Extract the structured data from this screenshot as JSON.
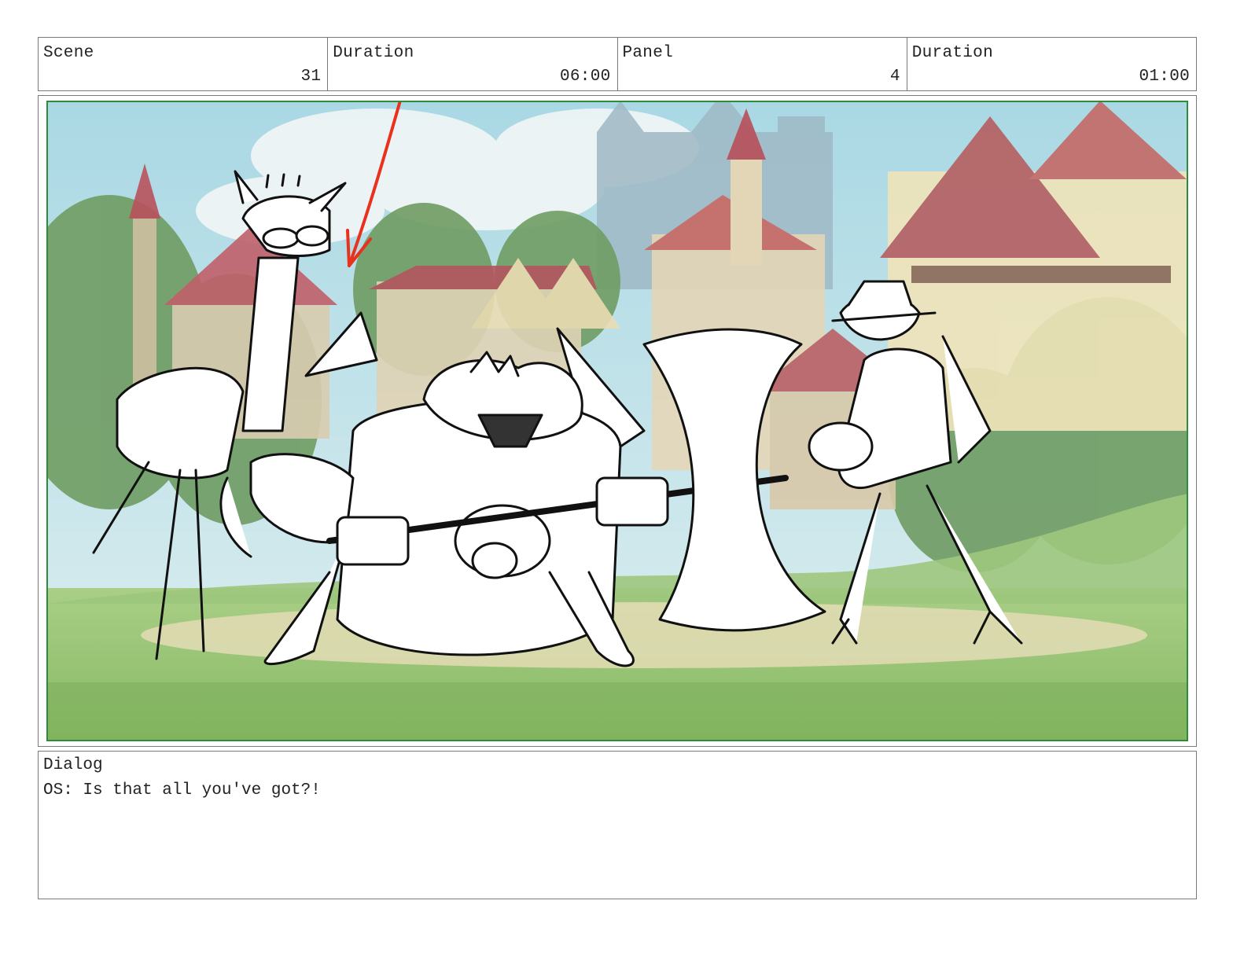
{
  "header": {
    "scene": {
      "label": "Scene",
      "value": "31"
    },
    "scene_duration": {
      "label": "Duration",
      "value": "06:00"
    },
    "panel": {
      "label": "Panel",
      "value": "4"
    },
    "panel_duration": {
      "label": "Duration",
      "value": "01:00"
    }
  },
  "dialog": {
    "label": "Dialog",
    "text": "OS: Is that all you've got?!"
  },
  "colors": {
    "frame_border": "#7a7a7a",
    "safe_area": "#2e8b3a",
    "annotation_arrow": "#e8321e"
  }
}
